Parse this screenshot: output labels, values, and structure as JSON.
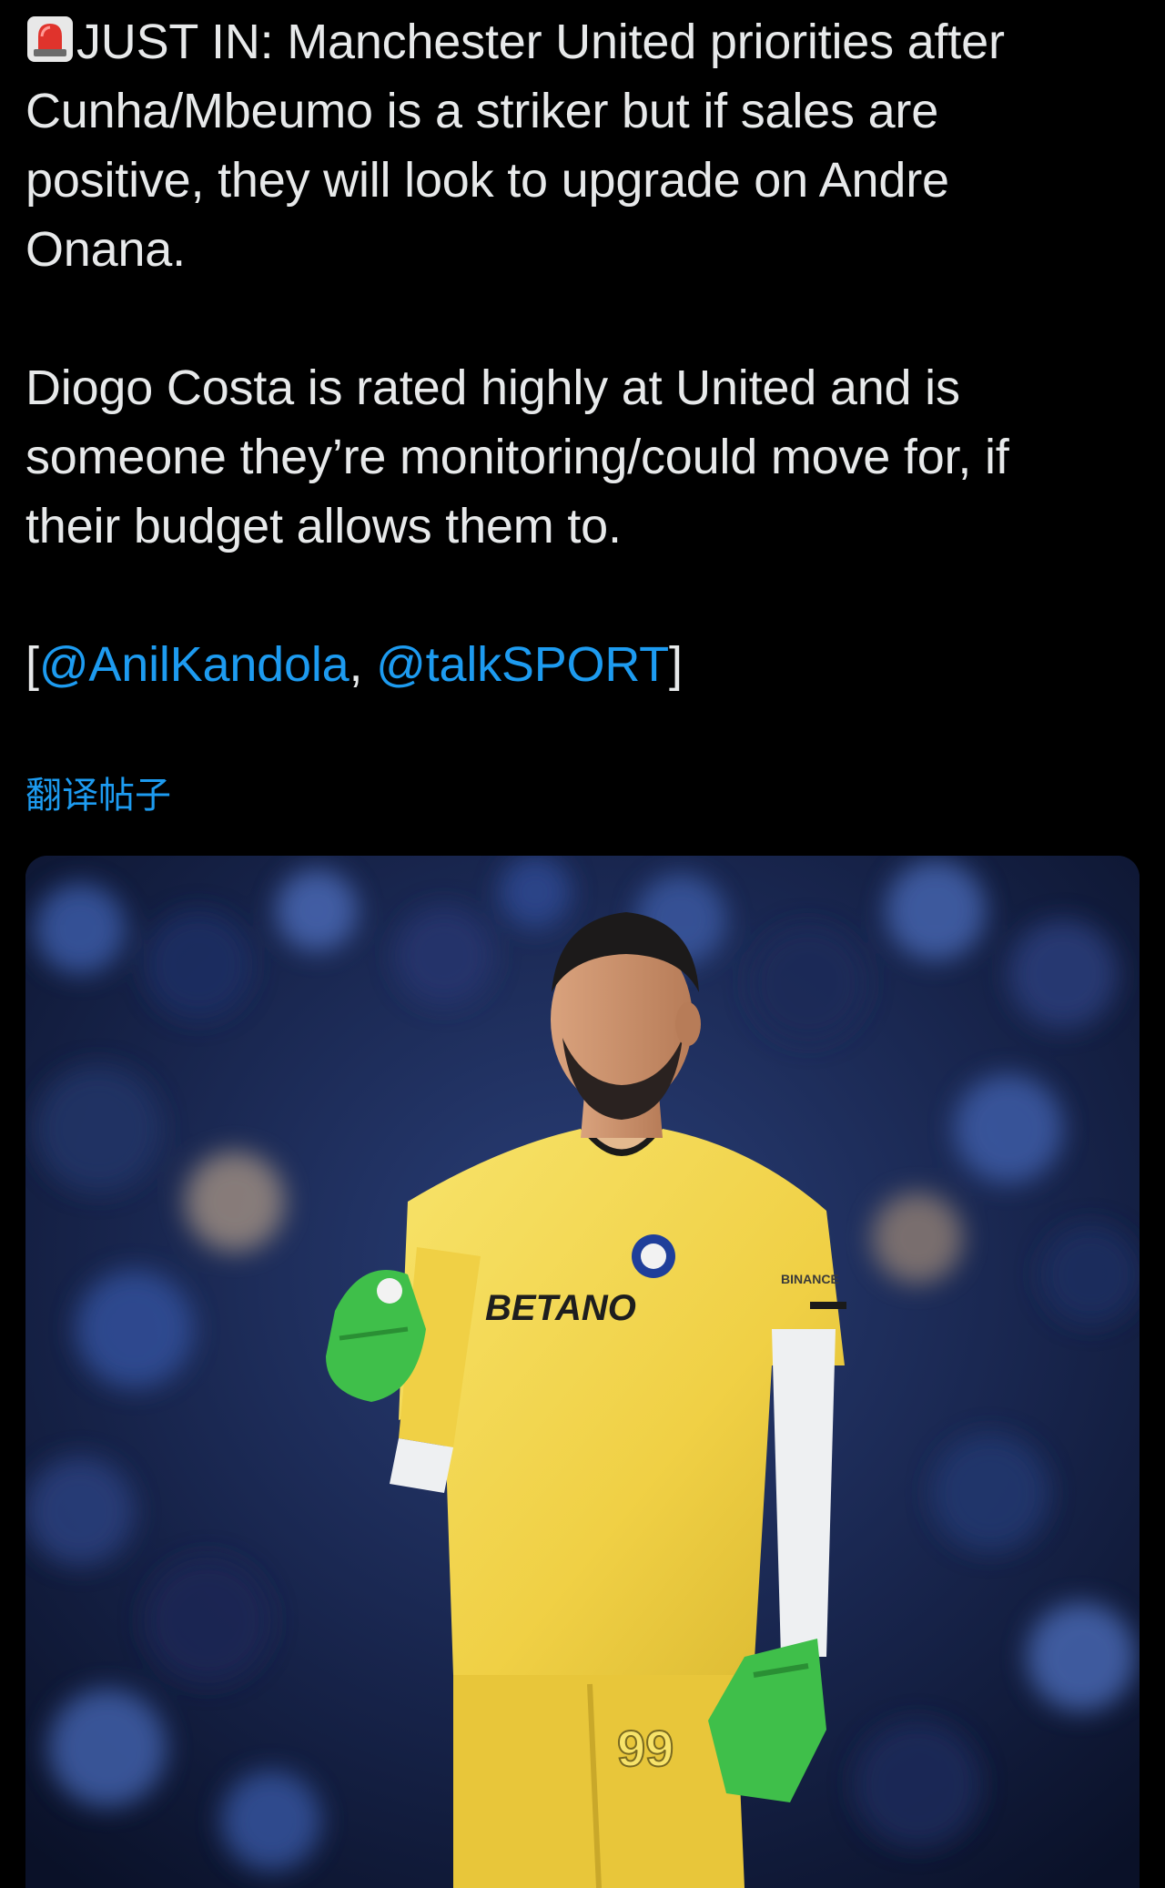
{
  "tweet": {
    "headline_badge_icon": "rotating-light-siren-icon",
    "headline": "JUST IN: Manchester United priorities after Cunha/Mbeumo is a striker but if sales are positive, they will look to upgrade on Andre Onana.",
    "line1": "JUST IN: Manchester United priorities after",
    "line2": "Cunha/Mbeumo is a striker but if sales are",
    "line3": "positive, they will look to upgrade on Andre",
    "line4": "Onana.",
    "para2_line1": "Diogo Costa is rated highly at United and is",
    "para2_line2": "someone they’re monitoring/could move for, if",
    "para2_line3": "their budget allows them to.",
    "sources_open": "[",
    "mention1": "@AnilKandola",
    "sources_sep": ", ",
    "mention2": "@talkSPORT",
    "sources_close": "]",
    "translate_label": "翻译帖子"
  },
  "media": {
    "kit_sponsor": "BETANO",
    "sleeve_sponsor": "BINANCE",
    "shorts_number": "99"
  },
  "colors": {
    "background": "#000000",
    "text": "#e7e9ea",
    "link": "#1d9bf0",
    "kit_yellow": "#f2d64b",
    "glove_green": "#3fbf4a"
  }
}
